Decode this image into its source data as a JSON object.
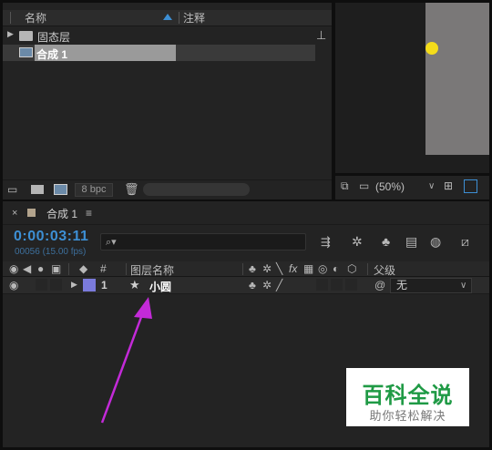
{
  "project_panel": {
    "columns": {
      "name": "名称",
      "comment": "注释"
    },
    "items": [
      {
        "label": "固态层",
        "type": "folder"
      },
      {
        "label": "合成 1",
        "type": "composition"
      }
    ],
    "footer": {
      "bpc": "8 bpc"
    }
  },
  "viewer": {
    "zoom": "(50%)"
  },
  "timeline": {
    "tab_label": "合成 1",
    "timecode": "0:00:03:11",
    "frames": "00056 (15.00 fps)",
    "columns": {
      "num": "#",
      "layer_name": "图层名称",
      "parent": "父级"
    },
    "layer": {
      "index": "1",
      "name": "小圆",
      "parent_value": "无"
    }
  },
  "watermark": {
    "title": "百科全说",
    "subtitle": "助你轻松解决"
  },
  "colors": {
    "timecode": "#3d8fd4",
    "layer_label": "#7b7bdc",
    "dot": "#f4dc1a",
    "arrow": "#c32ad8",
    "watermark_green": "#1f9a45"
  }
}
